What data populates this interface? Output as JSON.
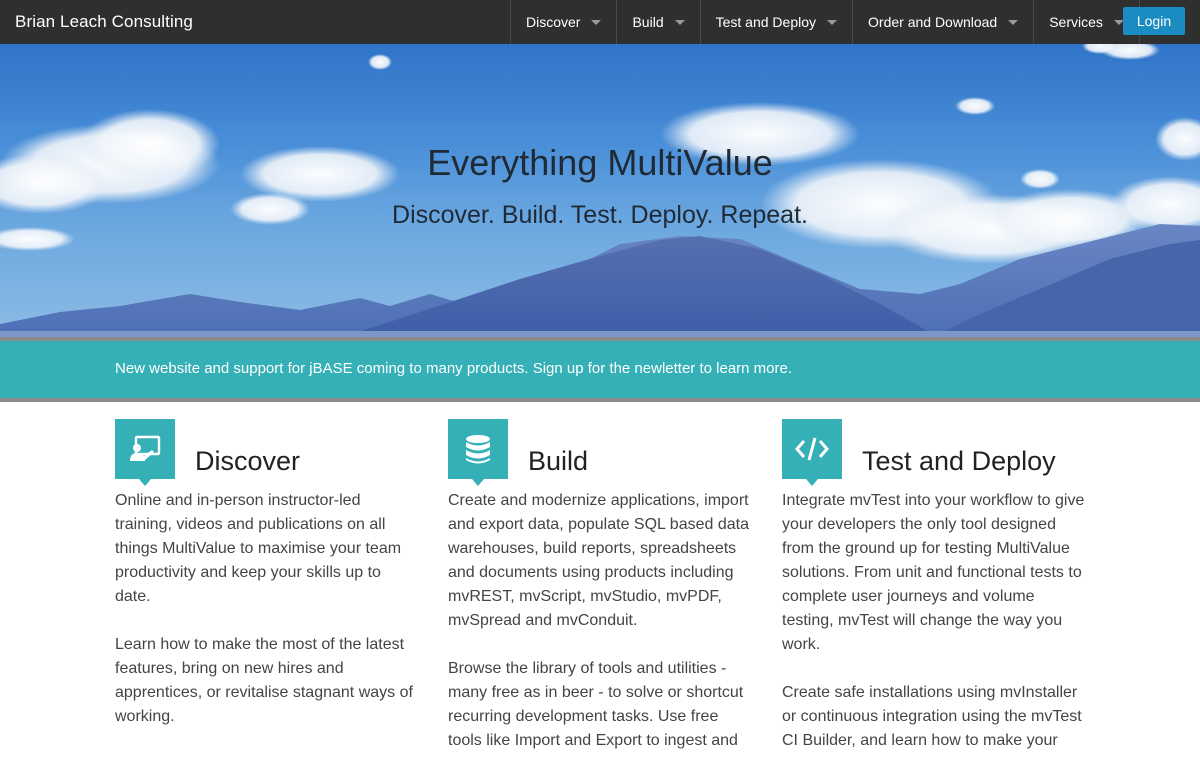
{
  "navbar": {
    "brand": "Brian Leach Consulting",
    "items": [
      {
        "label": "Discover"
      },
      {
        "label": "Build"
      },
      {
        "label": "Test and Deploy"
      },
      {
        "label": "Order and Download"
      },
      {
        "label": "Services"
      }
    ],
    "login_label": "Login"
  },
  "hero": {
    "title": "Everything MultiValue",
    "subtitle": "Discover. Build. Test. Deploy. Repeat."
  },
  "banner": {
    "text": "New website and support for jBASE coming to many products. Sign up for the newletter to learn more."
  },
  "columns": [
    {
      "icon": "presentation-icon",
      "title": "Discover",
      "paragraphs": [
        "Online and in-person instructor-led training, videos and publications on all things MultiValue to maximise your team productivity and keep your skills up to date.",
        "Learn how to make the most of the latest features, bring on new hires and apprentices, or revitalise stagnant ways of working."
      ]
    },
    {
      "icon": "database-icon",
      "title": "Build",
      "paragraphs": [
        "Create and modernize applications, import and export data, populate SQL based data warehouses, build reports, spreadsheets and documents using products including mvREST, mvScript, mvStudio, mvPDF, mvSpread and mvConduit.",
        "Browse the library of tools and utilities - many free as in beer - to solve or shortcut recurring development tasks. Use free tools like Import and Export to ingest and"
      ]
    },
    {
      "icon": "code-icon",
      "title": "Test and Deploy",
      "paragraphs": [
        "Integrate mvTest into your workflow to give your developers the only tool designed from the ground up for testing MultiValue solutions. From unit and functional tests to complete user journeys and volume testing, mvTest will change the way you work.",
        "Create safe installations using mvInstaller or continuous integration using the mvTest CI Builder, and learn how to make your"
      ]
    }
  ],
  "colors": {
    "navbar": "#2f2f2f",
    "accent": "#34b0b6",
    "login": "#1a8cc2"
  }
}
